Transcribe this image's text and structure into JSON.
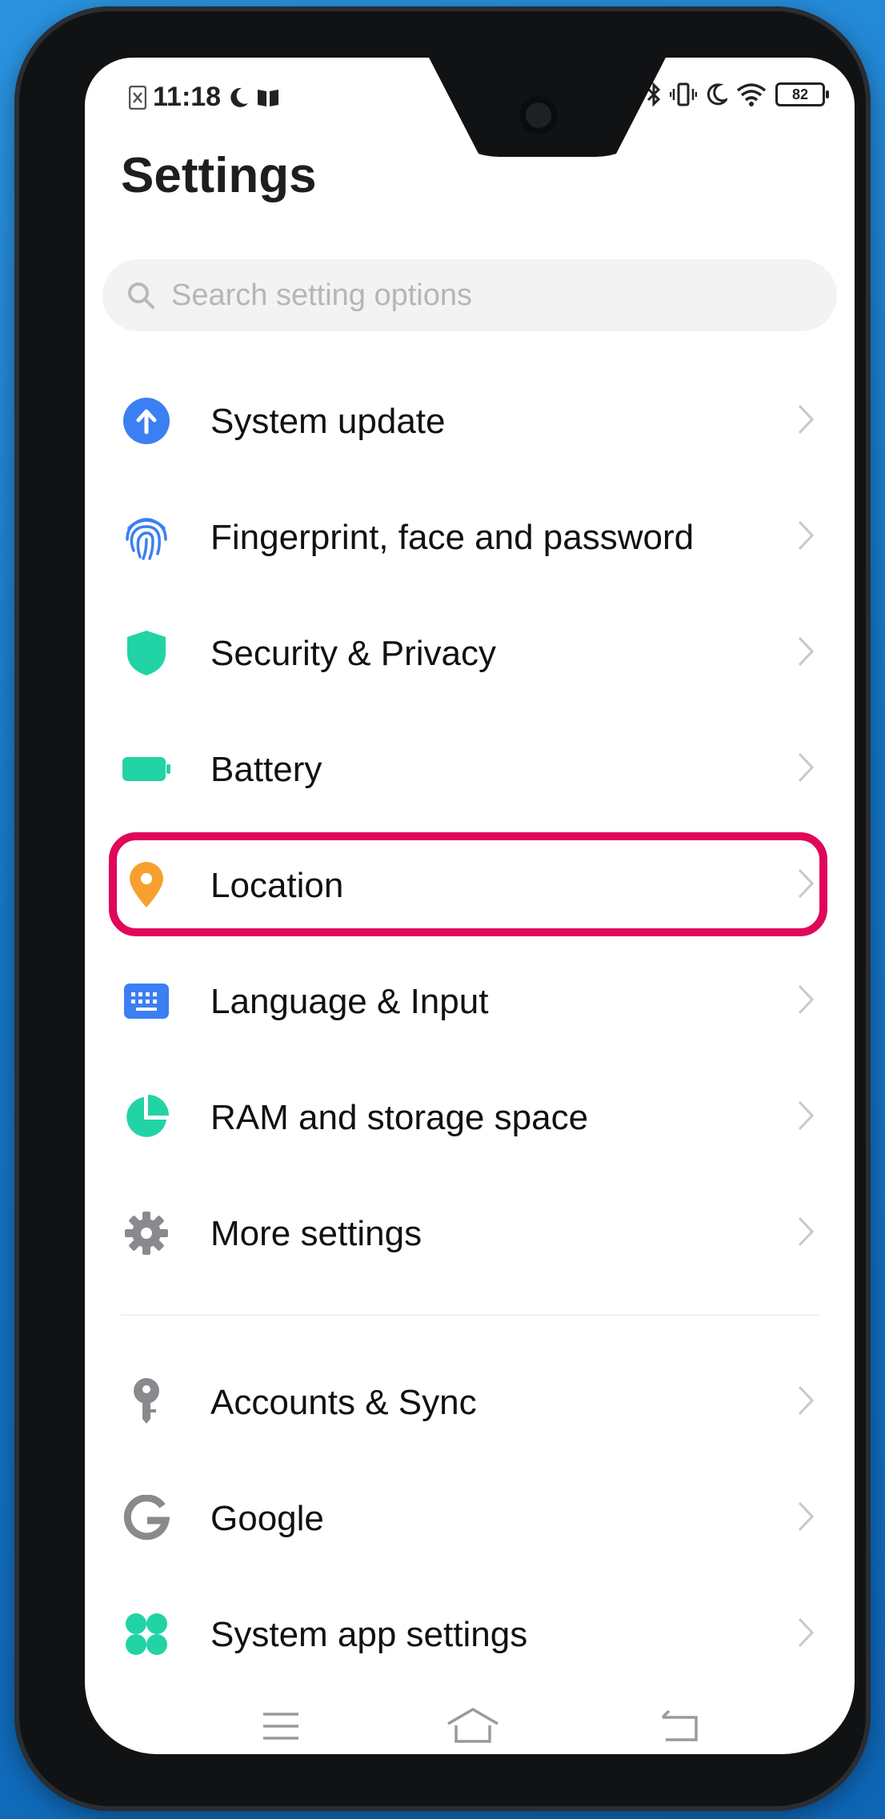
{
  "status_bar": {
    "time": "11:18",
    "battery": "82",
    "left_icons": [
      "sim-icon",
      "moon-icon",
      "book-icon"
    ],
    "right_icons": [
      "bluetooth-icon",
      "vibrate-icon",
      "moon-icon",
      "wifi-icon",
      "battery-icon"
    ]
  },
  "page": {
    "title": "Settings"
  },
  "search": {
    "placeholder": "Search setting options"
  },
  "settings": [
    {
      "label": "System update",
      "icon": "arrow-up-circle-icon",
      "color": "#3b7ff2"
    },
    {
      "label": "Fingerprint, face and password",
      "icon": "fingerprint-icon",
      "color": "#3b7ff2"
    },
    {
      "label": "Security & Privacy",
      "icon": "shield-icon",
      "color": "#22d3a6"
    },
    {
      "label": "Battery",
      "icon": "battery-icon",
      "color": "#22d3a6"
    },
    {
      "label": "Location",
      "icon": "location-pin-icon",
      "color": "#f7a030"
    },
    {
      "label": "Language & Input",
      "icon": "keyboard-icon",
      "color": "#3b7ff2"
    },
    {
      "label": "RAM and storage space",
      "icon": "pie-chart-icon",
      "color": "#22d3a6"
    },
    {
      "label": "More settings",
      "icon": "gear-icon",
      "color": "#8a8a8e"
    },
    {
      "label": "Accounts & Sync",
      "icon": "key-icon",
      "color": "#8a8a8e"
    },
    {
      "label": "Google",
      "icon": "google-icon",
      "color": "#8a8a8e"
    },
    {
      "label": "System app settings",
      "icon": "apps-grid-icon",
      "color": "#22d3a6"
    }
  ],
  "highlight_color": "#e0075a",
  "nav": [
    "menu-icon",
    "home-icon",
    "back-icon"
  ]
}
